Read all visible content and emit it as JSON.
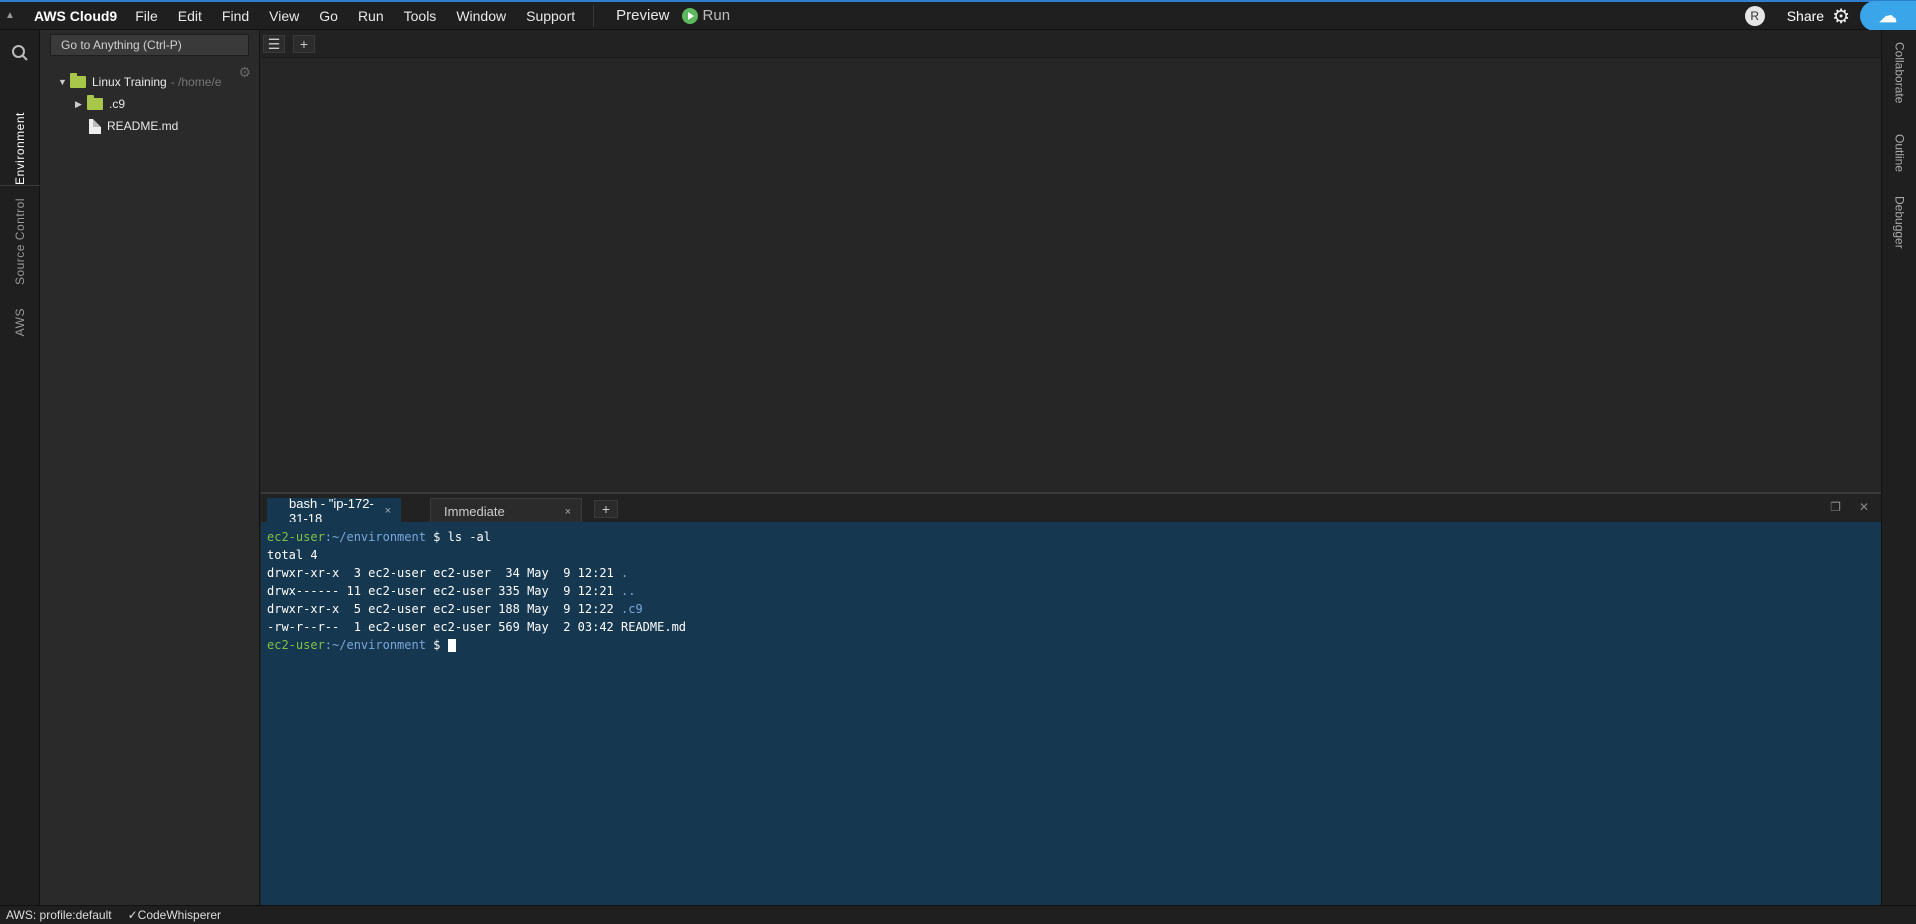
{
  "app": {
    "title": "AWS Cloud9"
  },
  "menu": [
    "File",
    "Edit",
    "Find",
    "View",
    "Go",
    "Run",
    "Tools",
    "Window",
    "Support"
  ],
  "toolbar": {
    "preview_label": "Preview",
    "run_label": "Run"
  },
  "user": {
    "avatar_initial": "R",
    "share_label": "Share"
  },
  "left_tabs": [
    "Environment",
    "Source Control",
    "AWS"
  ],
  "right_tabs": [
    "Collaborate",
    "Outline",
    "Debugger"
  ],
  "search": {
    "goto_placeholder": "Go to Anything (Ctrl-P)"
  },
  "tree": {
    "root": {
      "name": "Linux Training",
      "path": " - /home/e"
    },
    "items": [
      {
        "name": ".c9",
        "type": "folder"
      },
      {
        "name": "README.md",
        "type": "file"
      }
    ]
  },
  "editor_tabbar": {
    "plus": "+"
  },
  "terminal_tabs": [
    {
      "label": "bash - \"ip-172-31-18",
      "close": "×"
    },
    {
      "label": "Immediate",
      "close": "×"
    }
  ],
  "terminal": {
    "prompt_user": "ec2-user",
    "prompt_path": ":~/environment",
    "prompt_symbol": " $ ",
    "command": "ls -al",
    "output": [
      {
        "text": "total 4",
        "name": ""
      },
      {
        "text": "drwxr-xr-x  3 ec2-user ec2-user  34 May  9 12:21 ",
        "name": "."
      },
      {
        "text": "drwx------ 11 ec2-user ec2-user 335 May  9 12:21 ",
        "name": ".."
      },
      {
        "text": "drwxr-xr-x  5 ec2-user ec2-user 188 May  9 12:22 ",
        "name": ".c9"
      },
      {
        "text": "-rw-r--r--  1 ec2-user ec2-user 569 May  2 03:42 README.md",
        "name": ""
      }
    ]
  },
  "status": {
    "profile": "AWS: profile:default",
    "codewhisperer": "CodeWhisperer"
  },
  "colors": {
    "accent": "#2f7fd0",
    "terminal_bg": "#163750",
    "user_green": "#7fc247",
    "path_blue": "#7aa6da",
    "folder": "#a8c64a"
  }
}
